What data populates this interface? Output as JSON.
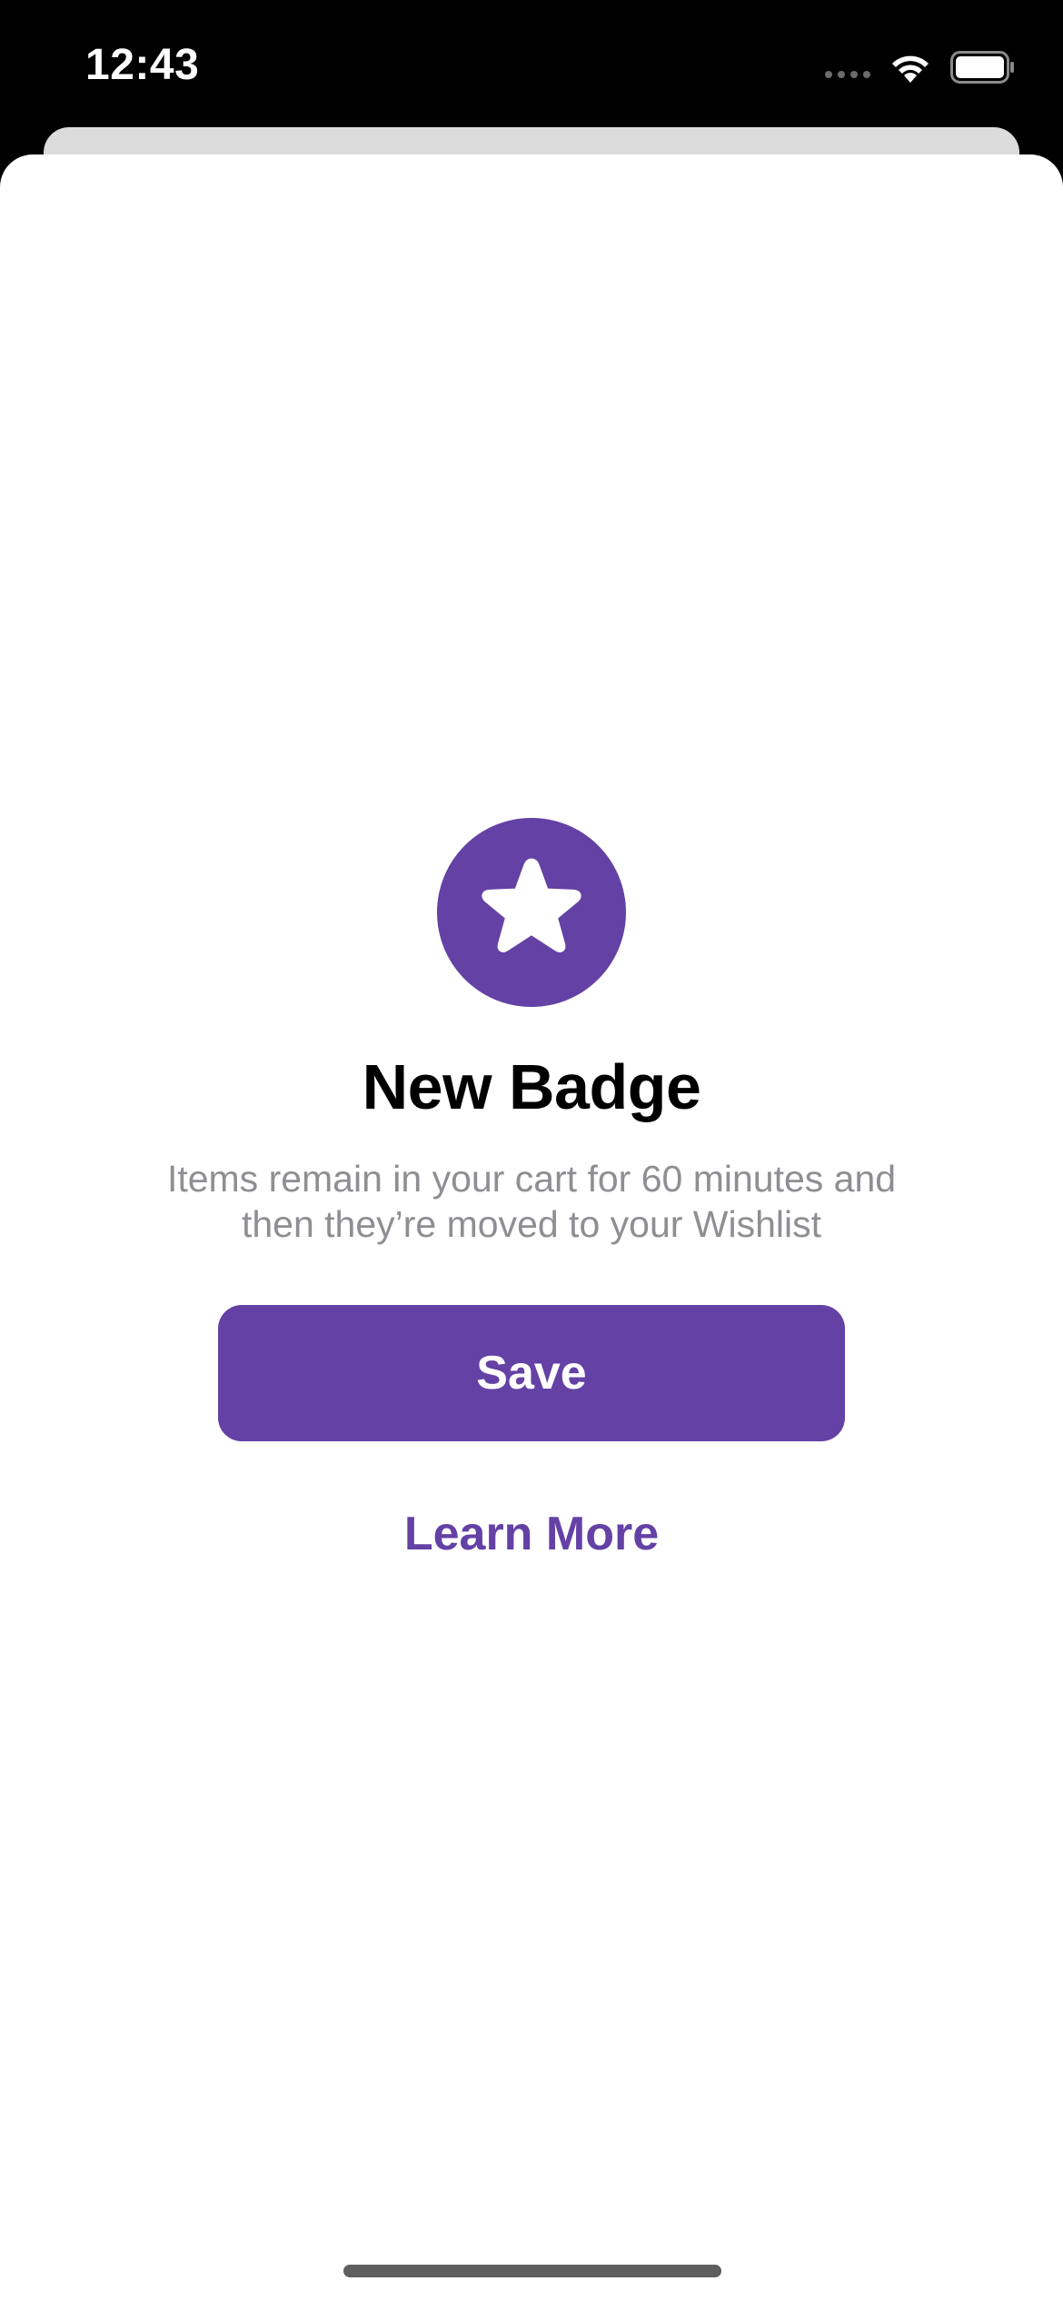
{
  "status_bar": {
    "time": "12:43",
    "icons": [
      "cellular-signal-icon",
      "wifi-icon",
      "battery-icon"
    ]
  },
  "sheet": {
    "badge_icon": "star-icon",
    "title": "New Badge",
    "subtitle": "Items remain in your cart for 60 minutes and then they’re moved to your Wishlist",
    "primary_button_label": "Save",
    "secondary_link_label": "Learn More"
  },
  "colors": {
    "accent": "#6441a5",
    "subtitle": "#8e8e93",
    "background": "#ffffff",
    "status_bar_background": "#000000"
  }
}
